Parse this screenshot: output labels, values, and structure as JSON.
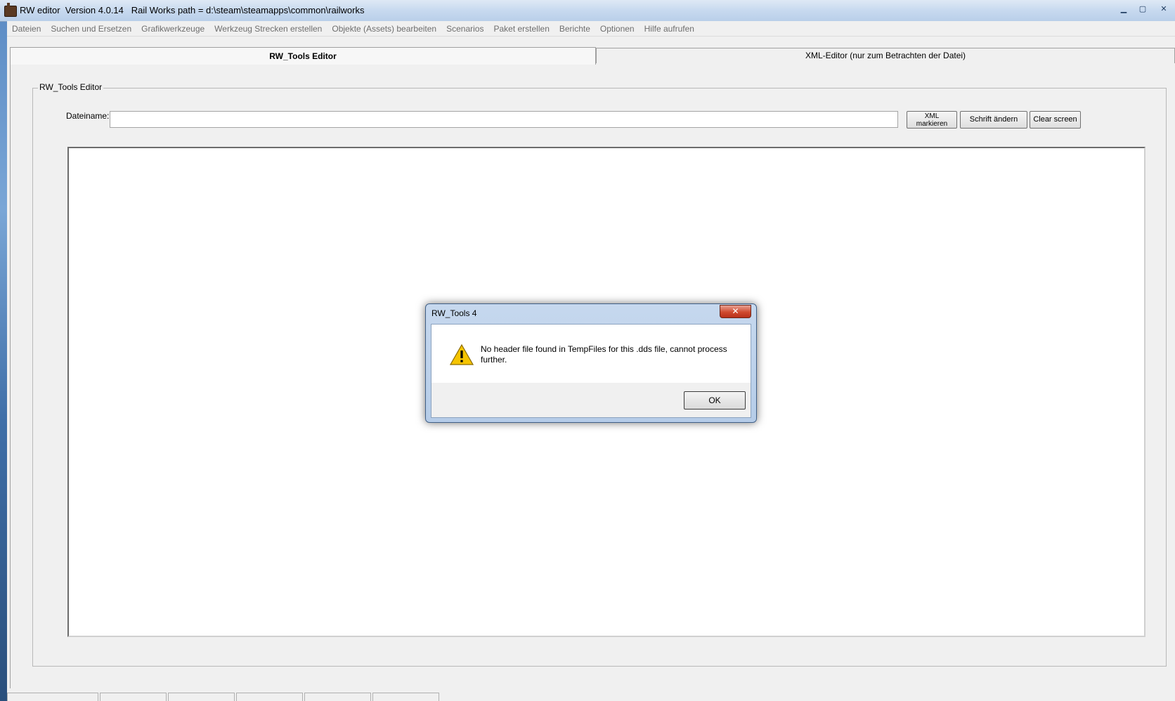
{
  "window": {
    "title": "RW editor  Version 4.0.14   Rail Works path = d:\\steam\\steamapps\\common\\railworks",
    "minimize": "▁",
    "maximize": "▢",
    "close": "✕"
  },
  "menu": {
    "items": [
      "Dateien",
      "Suchen und Ersetzen",
      "Grafikwerkzeuge",
      "Werkzeug Strecken erstellen",
      "Objekte (Assets) bearbeiten",
      "Scenarios",
      "Paket erstellen",
      "Berichte",
      "Optionen",
      "Hilfe aufrufen"
    ]
  },
  "tabs": {
    "active": "RW_Tools Editor",
    "inactive": "XML-Editor (nur zum Betrachten der Datei)"
  },
  "editor": {
    "group_label": "RW_Tools Editor",
    "filename_label": "Dateiname:",
    "filename_value": "",
    "btn_xml_line1": "XML",
    "btn_xml_line2": "markieren",
    "btn_font": "Schrift ändern",
    "btn_clear": "Clear screen",
    "content": ""
  },
  "dialog": {
    "title": "RW_Tools 4",
    "close": "✕",
    "message": "No header file found in TempFiles for this .dds file, cannot process further.",
    "ok": "OK",
    "icon": "warning-icon"
  },
  "colors": {
    "titlebar": "#c7d9ef",
    "dialog_frame": "#b5cce8",
    "close_red": "#d04a2f",
    "warning_yellow": "#f5c400"
  }
}
